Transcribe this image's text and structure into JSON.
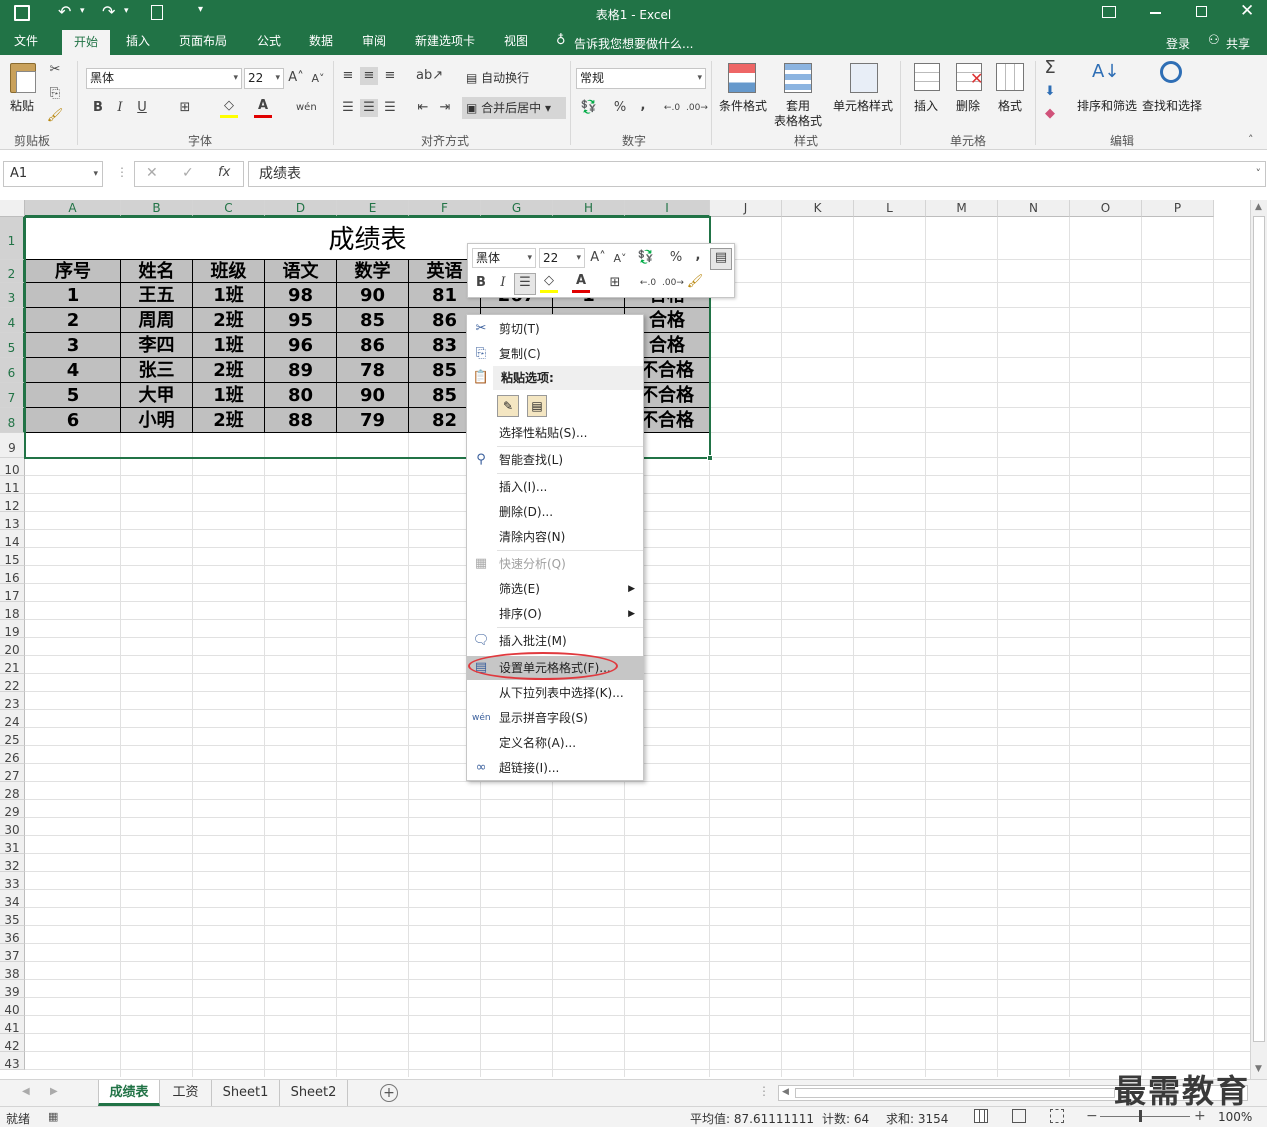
{
  "titlebar": {
    "title": "表格1 - Excel"
  },
  "tabs": [
    {
      "label": "文件"
    },
    {
      "label": "开始"
    },
    {
      "label": "插入"
    },
    {
      "label": "页面布局"
    },
    {
      "label": "公式"
    },
    {
      "label": "数据"
    },
    {
      "label": "审阅"
    },
    {
      "label": "新建选项卡"
    },
    {
      "label": "视图"
    }
  ],
  "tellme": "告诉我您想要做什么...",
  "account": {
    "login": "登录",
    "share": "共享"
  },
  "ribbon": {
    "clipboard": {
      "paste": "粘贴",
      "group": "剪贴板"
    },
    "font": {
      "name": "黑体",
      "size": "22",
      "bold": "B",
      "italic": "I",
      "underline": "U",
      "group": "字体"
    },
    "align": {
      "wrap": "自动换行",
      "merge": "合并后居中",
      "group": "对齐方式"
    },
    "number": {
      "format": "常规",
      "percent": "%",
      "comma": ",",
      "group": "数字"
    },
    "styles": {
      "cond": "条件格式",
      "table1": "套用",
      "table2": "表格格式",
      "cell": "单元格样式",
      "group": "样式"
    },
    "cells": {
      "insert": "插入",
      "delete": "删除",
      "format": "格式",
      "group": "单元格"
    },
    "edit": {
      "sort": "排序和筛选",
      "find": "查找和选择",
      "group": "编辑"
    }
  },
  "formula_bar": {
    "namebox": "A1",
    "fx": "fx",
    "content": "成绩表"
  },
  "columns": [
    "A",
    "B",
    "C",
    "D",
    "E",
    "F",
    "G",
    "H",
    "I",
    "J",
    "K",
    "L",
    "M",
    "N",
    "O",
    "P"
  ],
  "rows": [
    "1",
    "2",
    "3",
    "4",
    "5",
    "6",
    "7",
    "8",
    "9",
    "10",
    "11",
    "12",
    "13",
    "14",
    "15",
    "16",
    "17",
    "18",
    "19",
    "20",
    "21",
    "22",
    "23",
    "24",
    "25",
    "26",
    "27",
    "28",
    "29",
    "30",
    "31",
    "32",
    "33",
    "34",
    "35",
    "36",
    "37",
    "38",
    "39",
    "40",
    "41",
    "42",
    "43"
  ],
  "sheet": {
    "title": "成绩表",
    "headers": [
      "序号",
      "姓名",
      "班级",
      "语文",
      "数学",
      "英语",
      "",
      "",
      ""
    ],
    "data": [
      [
        "1",
        "王五",
        "1班",
        "98",
        "90",
        "81",
        "267",
        "1",
        "合格"
      ],
      [
        "2",
        "周周",
        "2班",
        "95",
        "85",
        "86",
        "",
        "",
        "合格"
      ],
      [
        "3",
        "李四",
        "1班",
        "96",
        "86",
        "83",
        "",
        "",
        "合格"
      ],
      [
        "4",
        "张三",
        "2班",
        "89",
        "78",
        "85",
        "",
        "",
        "不合格"
      ],
      [
        "5",
        "大甲",
        "1班",
        "80",
        "90",
        "85",
        "",
        "",
        "不合格"
      ],
      [
        "6",
        "小明",
        "2班",
        "88",
        "79",
        "82",
        "",
        "",
        "不合格"
      ]
    ]
  },
  "mini_toolbar": {
    "font": "黑体",
    "size": "22",
    "percent": "%",
    "comma": ",",
    "bold": "B",
    "italic": "I"
  },
  "context_menu": {
    "cut": "剪切(T)",
    "copy": "复制(C)",
    "paste_options": "粘贴选项:",
    "paste_special": "选择性粘贴(S)...",
    "smart_lookup": "智能查找(L)",
    "insert": "插入(I)...",
    "delete": "删除(D)...",
    "clear": "清除内容(N)",
    "quick_analysis": "快速分析(Q)",
    "filter": "筛选(E)",
    "sort": "排序(O)",
    "insert_comment": "插入批注(M)",
    "format_cells": "设置单元格格式(F)...",
    "pick_list": "从下拉列表中选择(K)...",
    "phonetic": "显示拼音字段(S)",
    "define_name": "定义名称(A)...",
    "hyperlink": "超链接(I)..."
  },
  "sheet_tabs": [
    "成绩表",
    "工资",
    "Sheet1",
    "Sheet2"
  ],
  "status": {
    "ready": "就绪",
    "average": "平均值: 87.61111111",
    "count": "计数: 64",
    "sum": "求和: 3154",
    "zoom": "100%"
  },
  "watermark": "最需教育",
  "colors": {
    "brand": "#217346",
    "highlight_ring": "#e0393e",
    "cell_fill": "#c0c0c0"
  }
}
